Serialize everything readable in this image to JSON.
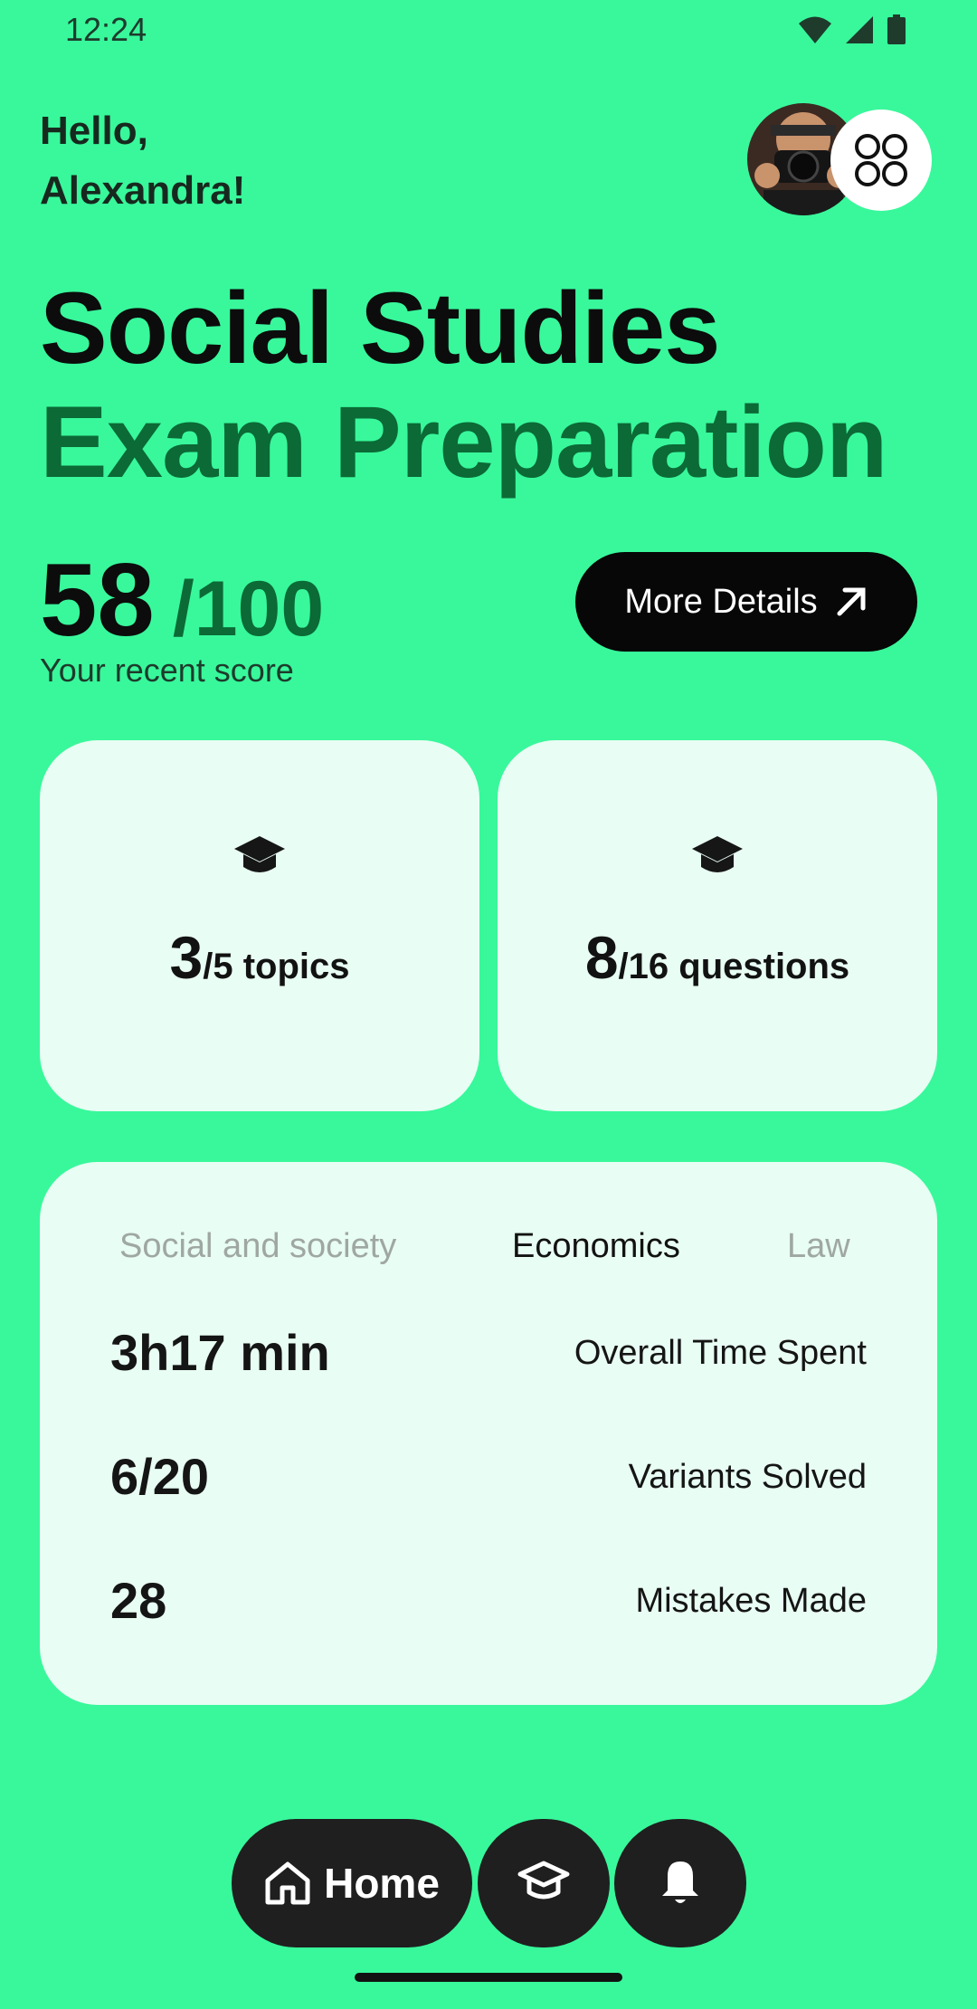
{
  "status_bar": {
    "time": "12:24"
  },
  "header": {
    "greeting_line1": "Hello,",
    "greeting_line2": "Alexandra!"
  },
  "title": {
    "line1": "Social Studies",
    "line2": "Exam Preparation"
  },
  "score": {
    "value": "58",
    "total": "/100",
    "label": "Your recent score",
    "details_button": "More Details"
  },
  "cards": [
    {
      "icon": "graduation-cap-icon",
      "value": "3",
      "suffix": "/5 topics"
    },
    {
      "icon": "graduation-cap-icon",
      "value": "8",
      "suffix": "/16 questions"
    }
  ],
  "panel": {
    "tabs": [
      {
        "label": "Social and society",
        "active": false
      },
      {
        "label": "Economics",
        "active": true
      },
      {
        "label": "Law",
        "active": false
      }
    ],
    "rows": [
      {
        "value": "3h17 min",
        "label": "Overall Time Spent"
      },
      {
        "value": "6/20",
        "label": "Variants Solved"
      },
      {
        "value": "28",
        "label": "Mistakes Made"
      }
    ]
  },
  "nav": {
    "home_label": "Home",
    "items": [
      "home-icon",
      "graduation-cap-icon",
      "bell-icon"
    ]
  },
  "colors": {
    "background": "#38f89b",
    "accent_dark_green": "#0b6a36",
    "card_background": "#e8fdf3",
    "nav_background": "#1f1f1f"
  }
}
